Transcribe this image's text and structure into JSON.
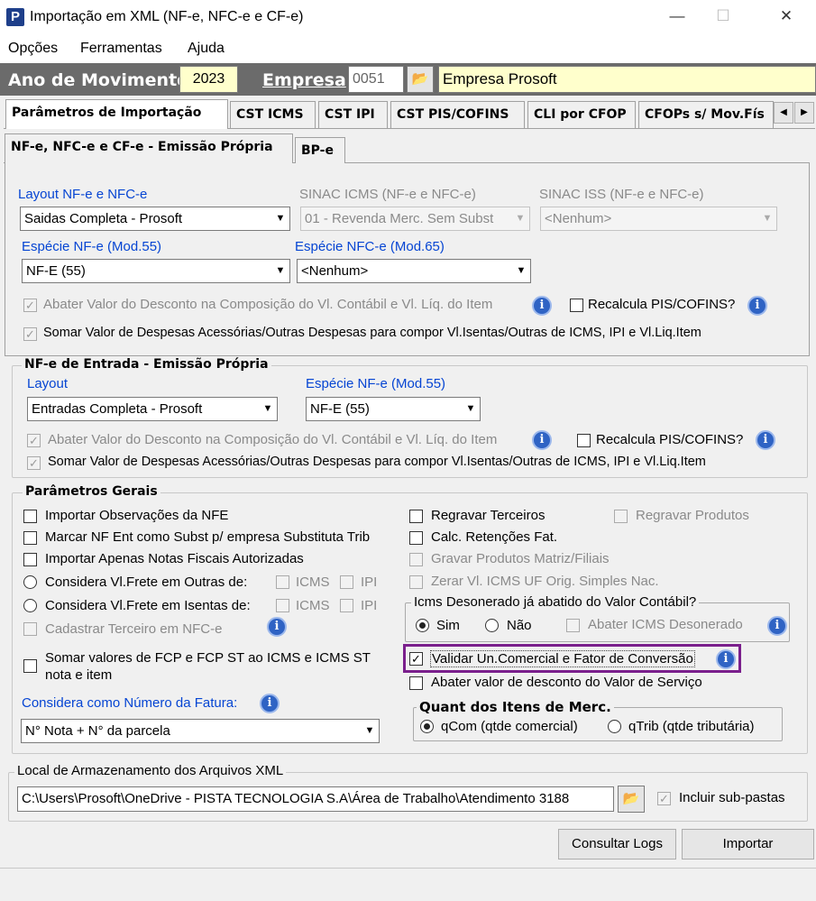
{
  "window": {
    "title": "Importação em XML (NF-e, NFC-e e CF-e)",
    "minimize": "—",
    "maximize": "☐",
    "close": "✕"
  },
  "menu": [
    "Opções",
    "Ferramentas",
    "Ajuda"
  ],
  "header": {
    "ano_label": "Ano de Movimento",
    "ano_value": "2023",
    "empresa_label": "Empresa",
    "empresa_code": "0051",
    "empresa_name": "Empresa Prosoft"
  },
  "tabs": [
    "Parâmetros de Importação",
    "CST ICMS",
    "CST IPI",
    "CST PIS/COFINS",
    "CLI por CFOP",
    "CFOPs s/ Mov.Fís"
  ],
  "subtabs": [
    "NF-e, NFC-e e CF-e - Emissão Própria",
    "BP-e"
  ],
  "emissao": {
    "layout_label": "Layout NF-e e NFC-e",
    "layout_value": "Saidas Completa - Prosoft",
    "sinac_icms_label": "SINAC ICMS (NF-e e NFC-e)",
    "sinac_icms_value": "01 - Revenda Merc. Sem Subst",
    "sinac_iss_label": "SINAC ISS (NF-e e NFC-e)",
    "sinac_iss_value": "<Nenhum>",
    "especie_nfe_label": "Espécie NF-e (Mod.55)",
    "especie_nfe_value": "NF-E (55)",
    "especie_nfce_label": "Espécie NFC-e (Mod.65)",
    "especie_nfce_value": "<Nenhum>",
    "abater_label": "Abater Valor do Desconto na Composição do Vl. Contábil e Vl. Líq. do Item",
    "recalcula_label": "Recalcula PIS/COFINS?",
    "somar_label": "Somar Valor de Despesas Acessórias/Outras Despesas para compor Vl.Isentas/Outras de ICMS, IPI e Vl.Liq.Item"
  },
  "entrada": {
    "title": "NF-e de Entrada - Emissão Própria",
    "layout_label": "Layout",
    "layout_value": "Entradas Completa - Prosoft",
    "especie_label": "Espécie NF-e (Mod.55)",
    "especie_value": "NF-E (55)",
    "abater_label": "Abater Valor do Desconto na Composição do Vl. Contábil e Vl. Líq. do Item",
    "recalcula_label": "Recalcula PIS/COFINS?",
    "somar_label": "Somar Valor de Despesas Acessórias/Outras Despesas para compor Vl.Isentas/Outras de ICMS, IPI e Vl.Liq.Item"
  },
  "gerais": {
    "title": "Parâmetros Gerais",
    "importar_obs": "Importar Observações da NFE",
    "marcar_nf": "Marcar NF Ent como Subst p/ empresa Substituta Trib",
    "importar_apenas": "Importar Apenas Notas Fiscais Autorizadas",
    "frete_outras": "Considera Vl.Frete em Outras de:",
    "frete_isentas": "Considera Vl.Frete em Isentas de:",
    "icms": "ICMS",
    "ipi": "IPI",
    "cadastrar": "Cadastrar Terceiro em NFC-e",
    "somar_fcp": "Somar valores de FCP e FCP ST ao ICMS e ICMS ST nota e item",
    "num_fatura_label": "Considera como Número da Fatura:",
    "num_fatura_value": "N° Nota + N° da parcela",
    "regravar_terceiros": "Regravar Terceiros",
    "regravar_produtos": "Regravar Produtos",
    "calc_retencoes": "Calc. Retenções Fat.",
    "gravar_produtos": "Gravar Produtos Matriz/Filiais",
    "zerar_icms": "Zerar Vl. ICMS UF Orig. Simples Nac.",
    "desonerado_title": "Icms Desonerado já abatido do Valor Contábil?",
    "sim": "Sim",
    "nao": "Não",
    "abater_desonerado": "Abater ICMS Desonerado",
    "validar": "Validar Un.Comercial e Fator de Conversão",
    "abater_servico": "Abater valor de desconto do Valor de Serviço",
    "quant_title": "Quant dos Itens de Merc.",
    "qcom": "qCom (qtde comercial)",
    "qtrib": "qTrib (qtde tributária)"
  },
  "local": {
    "title": "Local de Armazenamento dos Arquivos XML",
    "path": "C:\\Users\\Prosoft\\OneDrive - PISTA TECNOLOGIA S.A\\Área de Trabalho\\Atendimento 3188",
    "incluir": "Incluir sub-pastas"
  },
  "buttons": {
    "consultar": "Consultar Logs",
    "importar": "Importar"
  },
  "colors": {
    "header_bg": "#6b6b6b",
    "blue_label": "#0645d3",
    "highlight": "#7a1f8c",
    "yellow_field": "#ffffcc"
  }
}
